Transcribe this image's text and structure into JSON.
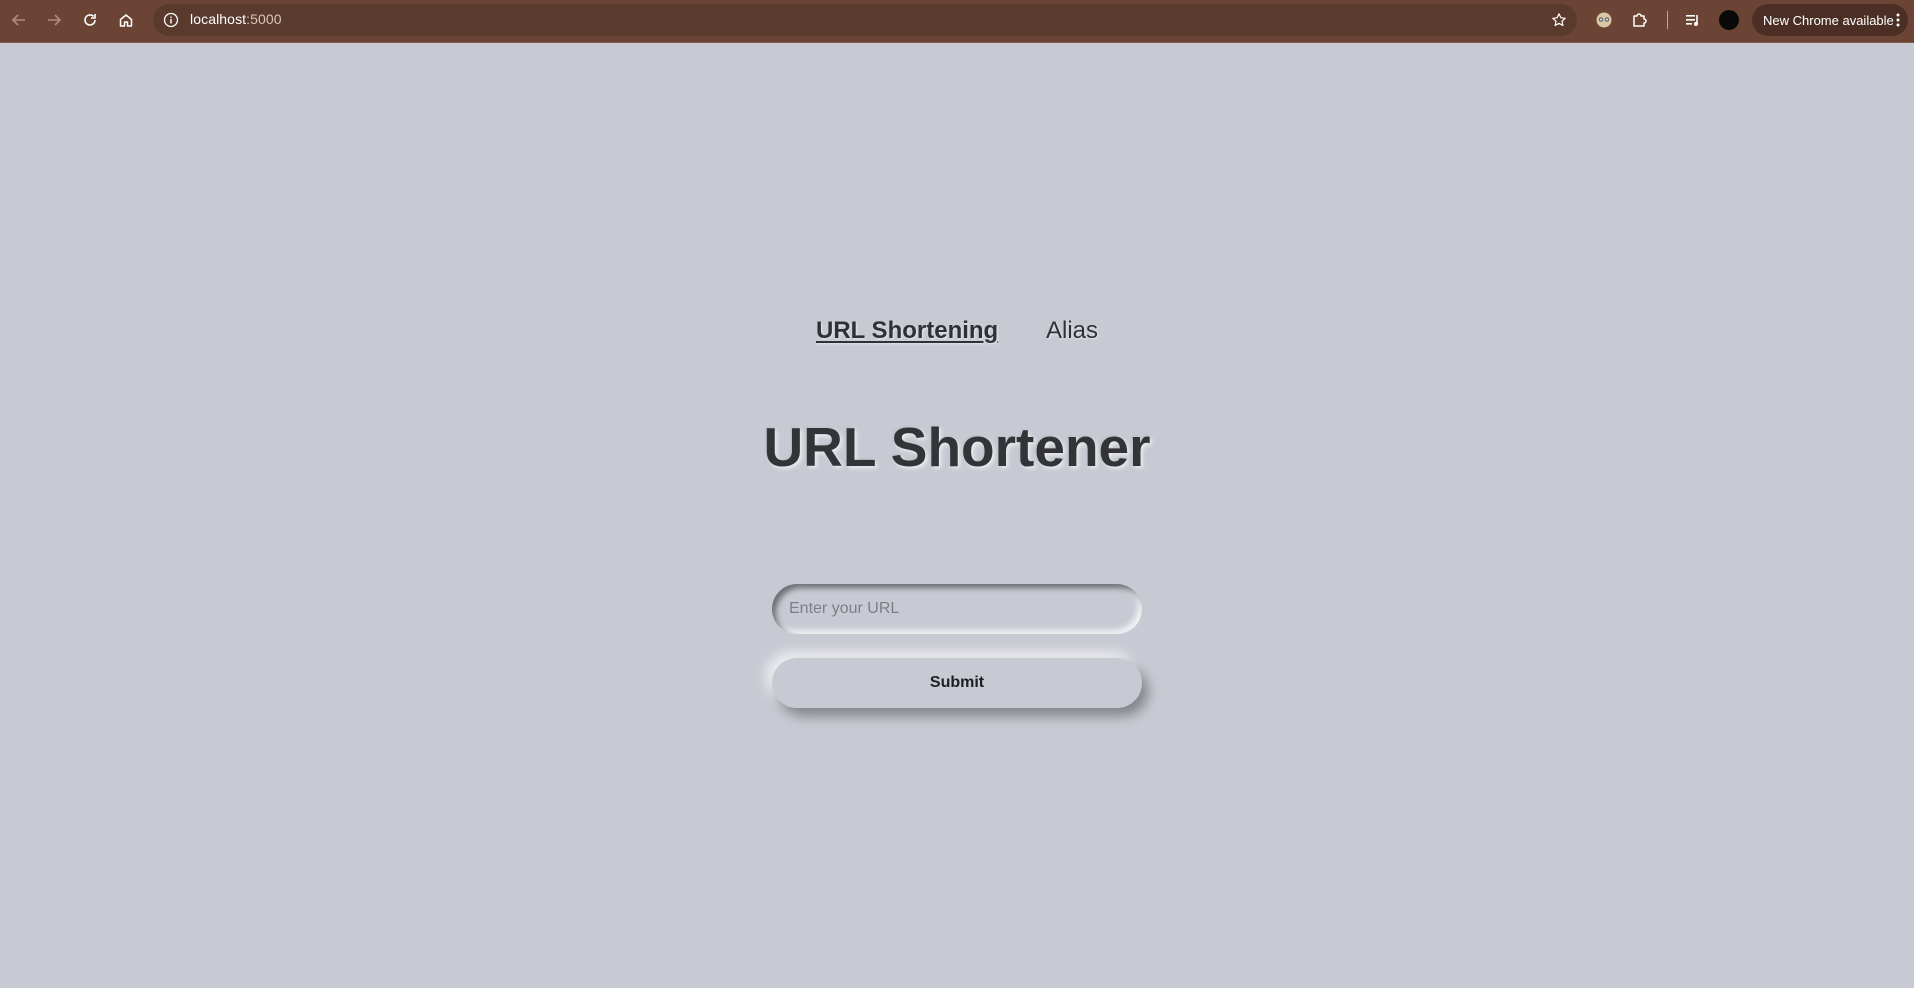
{
  "browser": {
    "url_host": "localhost",
    "url_port": ":5000",
    "update_chip": "New Chrome available",
    "icons": [
      "back-arrow-icon",
      "forward-arrow-icon",
      "reload-icon",
      "home-icon",
      "site-info-icon",
      "bookmark-star-icon",
      "extension-puzzle-icon",
      "media-queue-icon",
      "profile-avatar",
      "more-vert-icon"
    ]
  },
  "nav": {
    "links": [
      {
        "label": "URL Shortening",
        "active": true
      },
      {
        "label": "Alias",
        "active": false
      }
    ]
  },
  "main": {
    "title": "URL Shortener",
    "url_input": {
      "placeholder": "Enter your URL",
      "value": ""
    },
    "submit_label": "Submit"
  },
  "colors": {
    "page_background": "#c8cad3",
    "browser_bar": "#6b4436",
    "text": "#333438"
  }
}
